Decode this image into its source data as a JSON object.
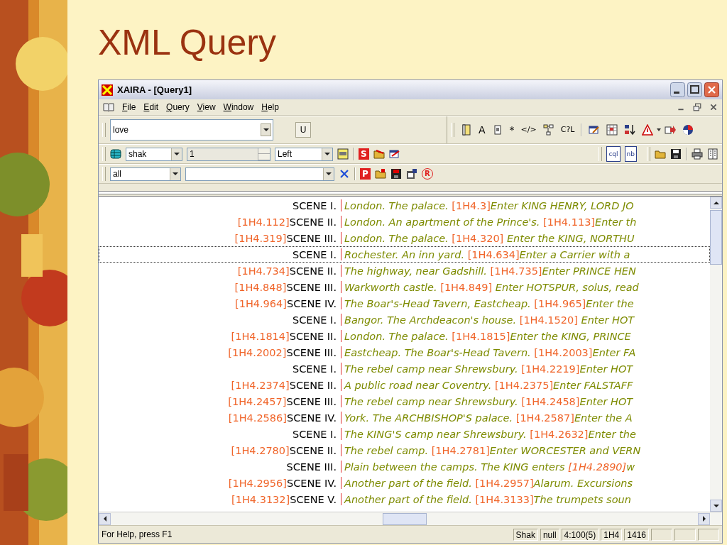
{
  "slide_title": "XML Query",
  "window": {
    "title": "XAIRA - [Query1]"
  },
  "menu": [
    "File",
    "Edit",
    "Query",
    "View",
    "Window",
    "Help"
  ],
  "toolbars": [
    {
      "query": "love",
      "button": "U",
      "glyphs": [
        "A",
        "*",
        "</>",
        "C?L"
      ]
    },
    {
      "corpus": "shak",
      "count": "1",
      "align": "Left",
      "glyphs": [
        "S",
        "cql",
        "nb"
      ]
    },
    {
      "filter": "all",
      "glyphs": [
        "P",
        "R"
      ]
    }
  ],
  "rows": [
    {
      "ref": "",
      "scene": "SCENE I.",
      "selected": false,
      "segments": [
        {
          "kind": "text",
          "text": "London. The palace. "
        },
        {
          "kind": "ref",
          "text": "[1H4.3]"
        },
        {
          "kind": "text",
          "text": "Enter KING HENRY, LORD JO"
        }
      ]
    },
    {
      "ref": "[1H4.112]",
      "scene": "SCENE II.",
      "selected": false,
      "segments": [
        {
          "kind": "text",
          "text": "London. An apartment of the Prince's. "
        },
        {
          "kind": "ref",
          "text": "[1H4.113]"
        },
        {
          "kind": "text",
          "text": "Enter th"
        }
      ]
    },
    {
      "ref": "[1H4.319]",
      "scene": "SCENE III.",
      "selected": false,
      "segments": [
        {
          "kind": "text",
          "text": "London. The palace. "
        },
        {
          "kind": "ref",
          "text": "[1H4.320]"
        },
        {
          "kind": "text",
          "text": " Enter the KING, NORTHU"
        }
      ]
    },
    {
      "ref": "",
      "scene": "SCENE I.",
      "selected": true,
      "segments": [
        {
          "kind": "text",
          "text": "Rochester. An inn yard. "
        },
        {
          "kind": "ref",
          "text": "[1H4.634]"
        },
        {
          "kind": "text",
          "text": "Enter a Carrier with a"
        }
      ]
    },
    {
      "ref": "[1H4.734]",
      "scene": "SCENE II.",
      "selected": false,
      "segments": [
        {
          "kind": "text",
          "text": "The highway, near Gadshill. "
        },
        {
          "kind": "ref",
          "text": "[1H4.735]"
        },
        {
          "kind": "text",
          "text": "Enter PRINCE HEN"
        }
      ]
    },
    {
      "ref": "[1H4.848]",
      "scene": "SCENE III.",
      "selected": false,
      "segments": [
        {
          "kind": "text",
          "text": "Warkworth castle. "
        },
        {
          "kind": "ref",
          "text": "[1H4.849]"
        },
        {
          "kind": "text",
          "text": " Enter HOTSPUR, solus, read"
        }
      ]
    },
    {
      "ref": "[1H4.964]",
      "scene": "SCENE IV.",
      "selected": false,
      "segments": [
        {
          "kind": "text",
          "text": "The Boar's-Head Tavern, Eastcheap. "
        },
        {
          "kind": "ref",
          "text": "[1H4.965]"
        },
        {
          "kind": "text",
          "text": "Enter the"
        }
      ]
    },
    {
      "ref": "",
      "scene": "SCENE I.",
      "selected": false,
      "segments": [
        {
          "kind": "text",
          "text": "Bangor. The Archdeacon's house. "
        },
        {
          "kind": "ref",
          "text": "[1H4.1520]"
        },
        {
          "kind": "text",
          "text": " Enter HOT"
        }
      ]
    },
    {
      "ref": "[1H4.1814]",
      "scene": "SCENE II.",
      "selected": false,
      "segments": [
        {
          "kind": "text",
          "text": "London. The palace. "
        },
        {
          "kind": "ref",
          "text": "[1H4.1815]"
        },
        {
          "kind": "text",
          "text": "Enter the KING, PRINCE"
        }
      ]
    },
    {
      "ref": "[1H4.2002]",
      "scene": "SCENE III.",
      "selected": false,
      "segments": [
        {
          "kind": "text",
          "text": "Eastcheap. The Boar's-Head Tavern. "
        },
        {
          "kind": "ref",
          "text": "[1H4.2003]"
        },
        {
          "kind": "text",
          "text": "Enter FA"
        }
      ]
    },
    {
      "ref": "",
      "scene": "SCENE I.",
      "selected": false,
      "segments": [
        {
          "kind": "text",
          "text": "The rebel camp near Shrewsbury. "
        },
        {
          "kind": "ref",
          "text": "[1H4.2219]"
        },
        {
          "kind": "text",
          "text": "Enter HOT"
        }
      ]
    },
    {
      "ref": "[1H4.2374]",
      "scene": "SCENE II.",
      "selected": false,
      "segments": [
        {
          "kind": "text",
          "text": "A public road near Coventry. "
        },
        {
          "kind": "ref",
          "text": "[1H4.2375]"
        },
        {
          "kind": "text",
          "text": "Enter FALSTAFF"
        }
      ]
    },
    {
      "ref": "[1H4.2457]",
      "scene": "SCENE III.",
      "selected": false,
      "segments": [
        {
          "kind": "text",
          "text": "The rebel camp near Shrewsbury. "
        },
        {
          "kind": "ref",
          "text": "[1H4.2458]"
        },
        {
          "kind": "text",
          "text": "Enter HOT"
        }
      ]
    },
    {
      "ref": "[1H4.2586]",
      "scene": "SCENE IV.",
      "selected": false,
      "segments": [
        {
          "kind": "text",
          "text": "York. The ARCHBISHOP'S palace. "
        },
        {
          "kind": "ref",
          "text": "[1H4.2587]"
        },
        {
          "kind": "text",
          "text": "Enter the A"
        }
      ]
    },
    {
      "ref": "",
      "scene": "SCENE I.",
      "selected": false,
      "segments": [
        {
          "kind": "text",
          "text": "The KING'S camp near Shrewsbury. "
        },
        {
          "kind": "ref",
          "text": "[1H4.2632]"
        },
        {
          "kind": "text",
          "text": "Enter the"
        }
      ]
    },
    {
      "ref": "[1H4.2780]",
      "scene": "SCENE II.",
      "selected": false,
      "segments": [
        {
          "kind": "text",
          "text": "The rebel camp. "
        },
        {
          "kind": "ref",
          "text": "[1H4.2781]"
        },
        {
          "kind": "text",
          "text": "Enter WORCESTER and VERN"
        }
      ]
    },
    {
      "ref": "",
      "scene": "SCENE III.",
      "selected": false,
      "segments": [
        {
          "kind": "text",
          "text": "Plain between the camps. The KING enters "
        },
        {
          "kind": "iref",
          "text": "[1H4.2890]"
        },
        {
          "kind": "text",
          "text": "w"
        }
      ]
    },
    {
      "ref": "[1H4.2956]",
      "scene": "SCENE IV.",
      "selected": false,
      "segments": [
        {
          "kind": "text",
          "text": "Another part of the field. "
        },
        {
          "kind": "ref",
          "text": "[1H4.2957]"
        },
        {
          "kind": "text",
          "text": "Alarum. Excursions"
        }
      ]
    },
    {
      "ref": "[1H4.3132]",
      "scene": "SCENE V.",
      "selected": false,
      "segments": [
        {
          "kind": "text",
          "text": "Another part of the field. "
        },
        {
          "kind": "ref",
          "text": "[1H4.3133]"
        },
        {
          "kind": "text",
          "text": "The trumpets soun"
        }
      ]
    }
  ],
  "status_bar": {
    "message": "For Help, press F1",
    "panels": [
      "Shak",
      "null",
      "4:100(5)",
      "1H4",
      "1416"
    ]
  }
}
